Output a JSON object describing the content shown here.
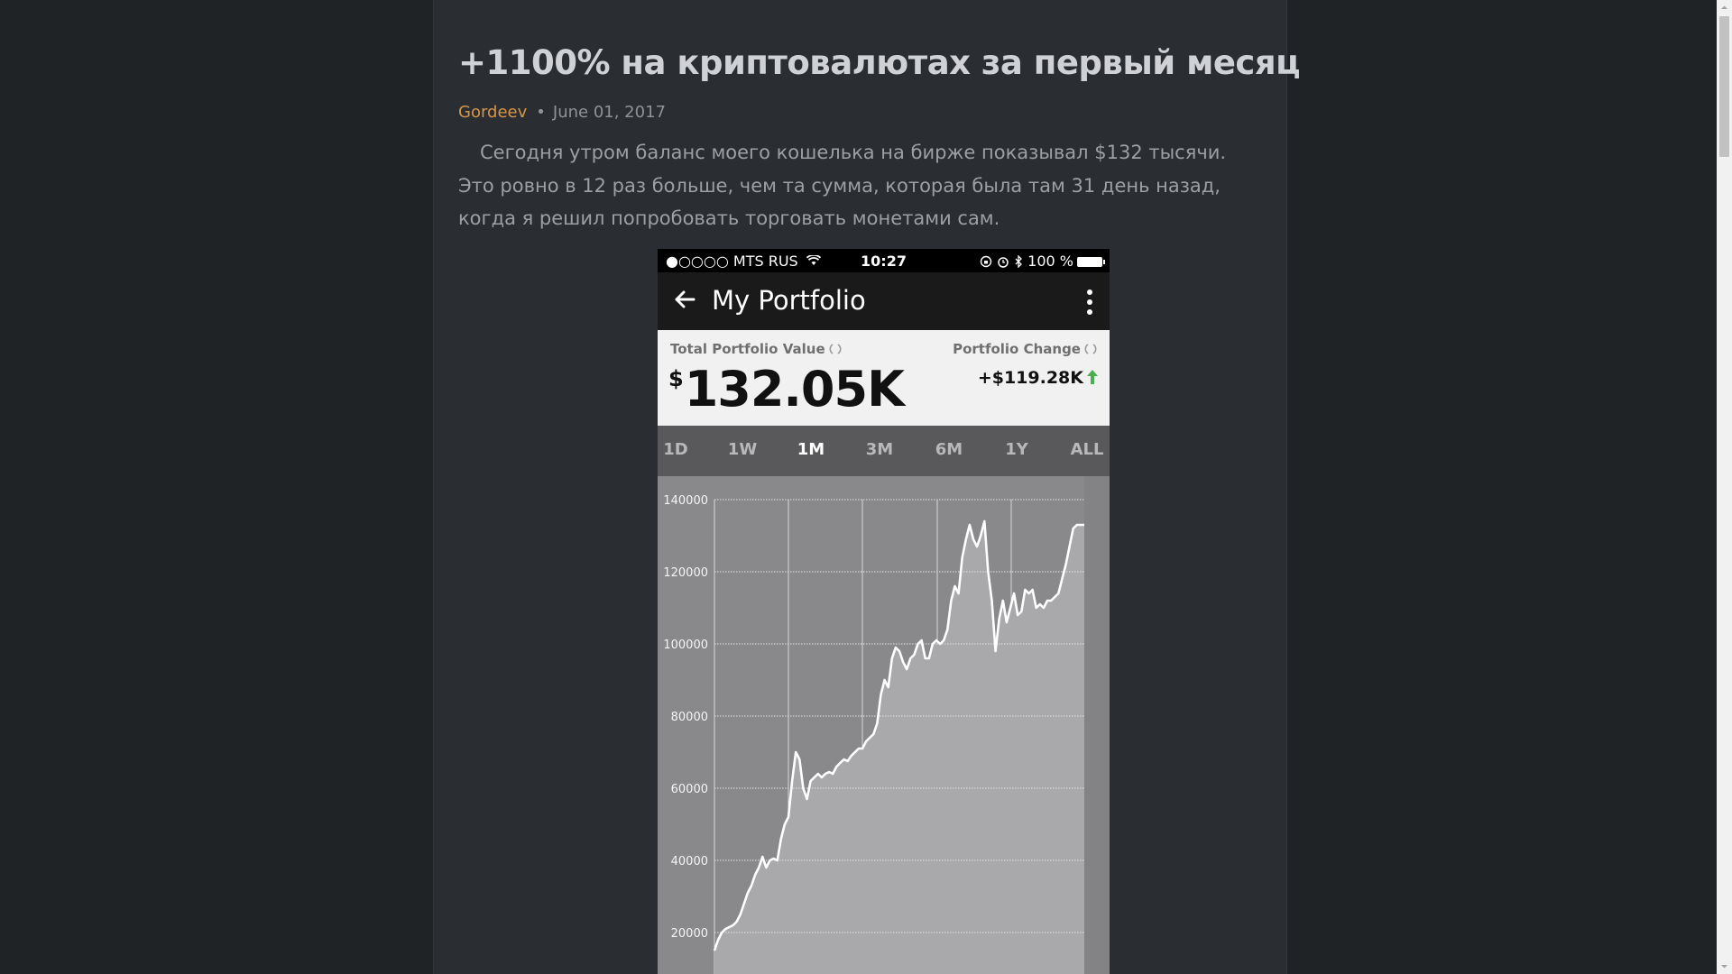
{
  "article": {
    "title": "+1100% на криптовалютах за первый месяц",
    "author": "Gordeev",
    "date": "June 01, 2017",
    "intro": "Сегодня утром баланс моего кошелька на бирже показывал $132 тысячи. Это ровно в 12 раз больше, чем та сумма, которая была там 31 день назад, когда я решил попробовать торговать монетами сам."
  },
  "phone": {
    "status": {
      "carrier": "●○○○○ MTS RUS",
      "time": "10:27",
      "battery": "100 %"
    },
    "app_title": "My Portfolio",
    "total_label": "Total Portfolio Value",
    "currency": "$",
    "total_value": "132.05K",
    "change_label": "Portfolio Change",
    "change_value": "+$119.28K",
    "tabs": [
      "1D",
      "1W",
      "1M",
      "3M",
      "6M",
      "1Y",
      "ALL"
    ],
    "active_tab": "1M",
    "colors": {
      "accent_up": "#4caf50",
      "author": "#d79548"
    }
  },
  "chart_data": {
    "type": "area",
    "title": "",
    "xlabel": "",
    "ylabel": "",
    "yticks": [
      20000,
      40000,
      60000,
      80000,
      100000,
      120000,
      140000
    ],
    "ylim": [
      15000,
      145000
    ],
    "grid": true,
    "x": [
      0,
      1,
      2,
      3,
      4,
      5,
      6,
      7,
      8,
      9,
      10,
      11,
      12,
      13,
      14,
      15,
      16,
      17,
      18,
      19,
      20,
      21,
      22,
      23,
      24,
      25,
      26,
      27,
      28,
      29,
      30,
      31,
      32,
      33,
      34,
      35,
      36,
      37,
      38,
      39,
      40,
      41,
      42,
      43,
      44,
      45,
      46,
      47,
      48,
      49,
      50,
      51,
      52,
      53,
      54,
      55,
      56,
      57,
      58,
      59,
      60,
      61,
      62,
      63,
      64,
      65,
      66,
      67,
      68,
      69,
      70,
      71,
      72,
      73,
      74,
      75,
      76,
      77,
      78,
      79,
      80,
      81,
      82,
      83,
      84,
      85,
      86,
      87,
      88,
      89,
      90,
      91,
      92,
      93,
      94,
      95,
      96,
      97,
      98,
      99,
      100
    ],
    "values": [
      15000,
      18000,
      20000,
      21000,
      21500,
      22000,
      23000,
      25000,
      28000,
      31000,
      33000,
      36000,
      38000,
      41000,
      38000,
      40000,
      40500,
      40000,
      46000,
      50000,
      52000,
      62000,
      70000,
      68000,
      60000,
      57000,
      62000,
      63000,
      64000,
      63000,
      64000,
      64500,
      64000,
      66000,
      67000,
      68000,
      67500,
      69000,
      70000,
      71000,
      71000,
      73000,
      74000,
      75000,
      78000,
      86000,
      90000,
      88000,
      96000,
      99000,
      98000,
      95000,
      93000,
      96000,
      97000,
      100000,
      101000,
      96000,
      96000,
      100000,
      101000,
      100000,
      101000,
      104000,
      112000,
      116000,
      114000,
      124000,
      129000,
      133000,
      129000,
      127000,
      130000,
      134000,
      120000,
      112000,
      98000,
      107000,
      112000,
      106000,
      110000,
      114000,
      108000,
      109000,
      115000,
      114000,
      115000,
      110000,
      111000,
      110000,
      112000,
      112000,
      113000,
      114000,
      118000,
      122000,
      127000,
      132000,
      133000,
      133000,
      133000
    ]
  }
}
